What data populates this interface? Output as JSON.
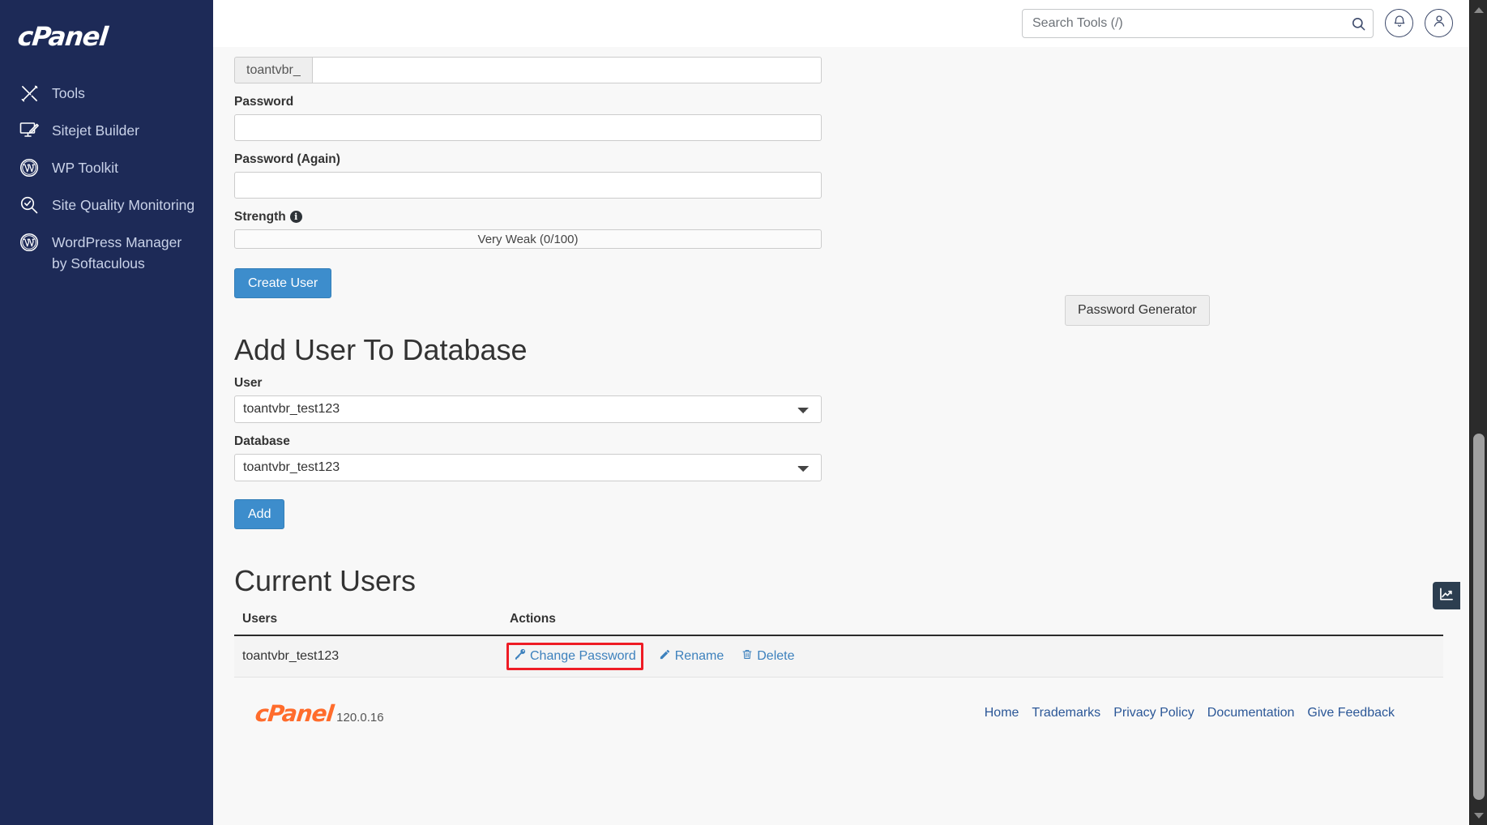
{
  "brand": {
    "logo_text": "cPanel"
  },
  "sidebar": {
    "items": [
      {
        "label": "Tools",
        "icon": "tools-icon"
      },
      {
        "label": "Sitejet Builder",
        "icon": "monitor-pen-icon"
      },
      {
        "label": "WP Toolkit",
        "icon": "wordpress-icon"
      },
      {
        "label": "Site Quality Monitoring",
        "icon": "magnifier-check-icon"
      },
      {
        "label": "WordPress Manager by Softaculous",
        "icon": "wordpress-icon"
      }
    ]
  },
  "header": {
    "search_placeholder": "Search Tools (/)",
    "search_value": "",
    "search_icon": "search-icon",
    "notifications_icon": "bell-icon",
    "account_icon": "user-icon"
  },
  "add_user": {
    "username_prefix": "toantvbr_",
    "username_value": "",
    "password_label": "Password",
    "password_value": "",
    "password_again_label": "Password (Again)",
    "password_again_value": "",
    "strength_label": "Strength",
    "strength_info_icon": "info-icon",
    "strength_value": "Very Weak (0/100)",
    "create_button": "Create User",
    "password_generator_button": "Password Generator"
  },
  "add_user_to_db": {
    "title": "Add User To Database",
    "user_label": "User",
    "user_selected": "toantvbr_test123",
    "user_options": [
      "toantvbr_test123"
    ],
    "database_label": "Database",
    "database_selected": "toantvbr_test123",
    "database_options": [
      "toantvbr_test123"
    ],
    "add_button": "Add"
  },
  "current_users": {
    "title": "Current Users",
    "columns": [
      "Users",
      "Actions"
    ],
    "rows": [
      {
        "user": "toantvbr_test123",
        "actions": [
          {
            "label": "Change Password",
            "icon": "key-icon",
            "highlighted": true
          },
          {
            "label": "Rename",
            "icon": "pencil-icon",
            "highlighted": false
          },
          {
            "label": "Delete",
            "icon": "trash-icon",
            "highlighted": false
          }
        ]
      }
    ]
  },
  "footer": {
    "logo_text": "cPanel",
    "version": "120.0.16",
    "links": [
      "Home",
      "Trademarks",
      "Privacy Policy",
      "Documentation",
      "Give Feedback"
    ]
  },
  "widgets": {
    "stats_tab_icon": "chart-line-icon"
  },
  "colors": {
    "sidebar_bg": "#1d2a57",
    "primary": "#3d8dcc",
    "link": "#3d81bd",
    "highlight": "#ee1c25",
    "footer_logo": "#ff6c2c",
    "content_bg": "#f8f8f8"
  }
}
